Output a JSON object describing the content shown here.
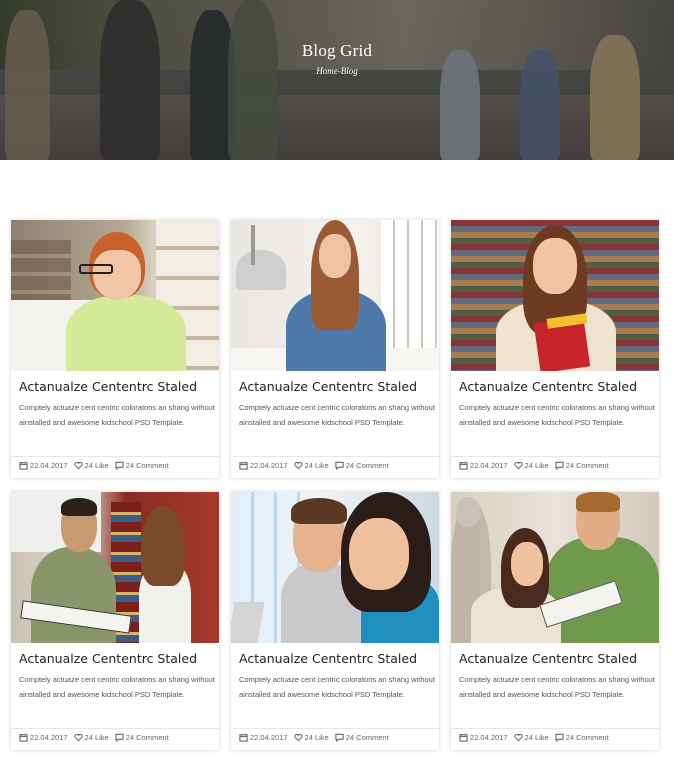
{
  "hero": {
    "title": "Blog Grid",
    "breadcrumb": {
      "home": "Home",
      "separator": "-",
      "current": "Blog"
    }
  },
  "posts": [
    {
      "title": "Actanualze Cententrc Staled",
      "excerpt": "Comptely actuaze cent centric coloratons an shang without ainstalled and awesome kidschool PSD Template.",
      "date": "22.04.2017",
      "likes": "24 Like",
      "comments": "24 Comment",
      "image": "student-with-glasses"
    },
    {
      "title": "Actanualze Cententrc Staled",
      "excerpt": "Comptely actuaze cent centric coloratons an shang without ainstalled and awesome kidschool PSD Template.",
      "date": "22.04.2017",
      "likes": "24 Like",
      "comments": "24 Comment",
      "image": "student-writing-at-desk"
    },
    {
      "title": "Actanualze Cententrc Staled",
      "excerpt": "Comptely actuaze cent centric coloratons an shang without ainstalled and awesome kidschool PSD Template.",
      "date": "22.04.2017",
      "likes": "24 Like",
      "comments": "24 Comment",
      "image": "student-holding-books-in-library"
    },
    {
      "title": "Actanualze Cententrc Staled",
      "excerpt": "Comptely actuaze cent centric coloratons an shang without ainstalled and awesome kidschool PSD Template.",
      "date": "22.04.2017",
      "likes": "24 Like",
      "comments": "24 Comment",
      "image": "students-reading-between-shelves"
    },
    {
      "title": "Actanualze Cententrc Staled",
      "excerpt": "Comptely actuaze cent centric coloratons an shang without ainstalled and awesome kidschool PSD Template.",
      "date": "22.04.2017",
      "likes": "24 Like",
      "comments": "24 Comment",
      "image": "smiling-students-portrait"
    },
    {
      "title": "Actanualze Cententrc Staled",
      "excerpt": "Comptely actuaze cent centric coloratons an shang without ainstalled and awesome kidschool PSD Template.",
      "date": "22.04.2017",
      "likes": "24 Like",
      "comments": "24 Comment",
      "image": "students-studying-together"
    }
  ],
  "colors": {
    "title_text": "#222222",
    "body_text": "#555555",
    "meta_text": "#666666",
    "card_border": "#e6e6e6"
  },
  "icons": {
    "date": "calendar-icon",
    "like": "heart-icon",
    "comment": "comment-icon"
  }
}
